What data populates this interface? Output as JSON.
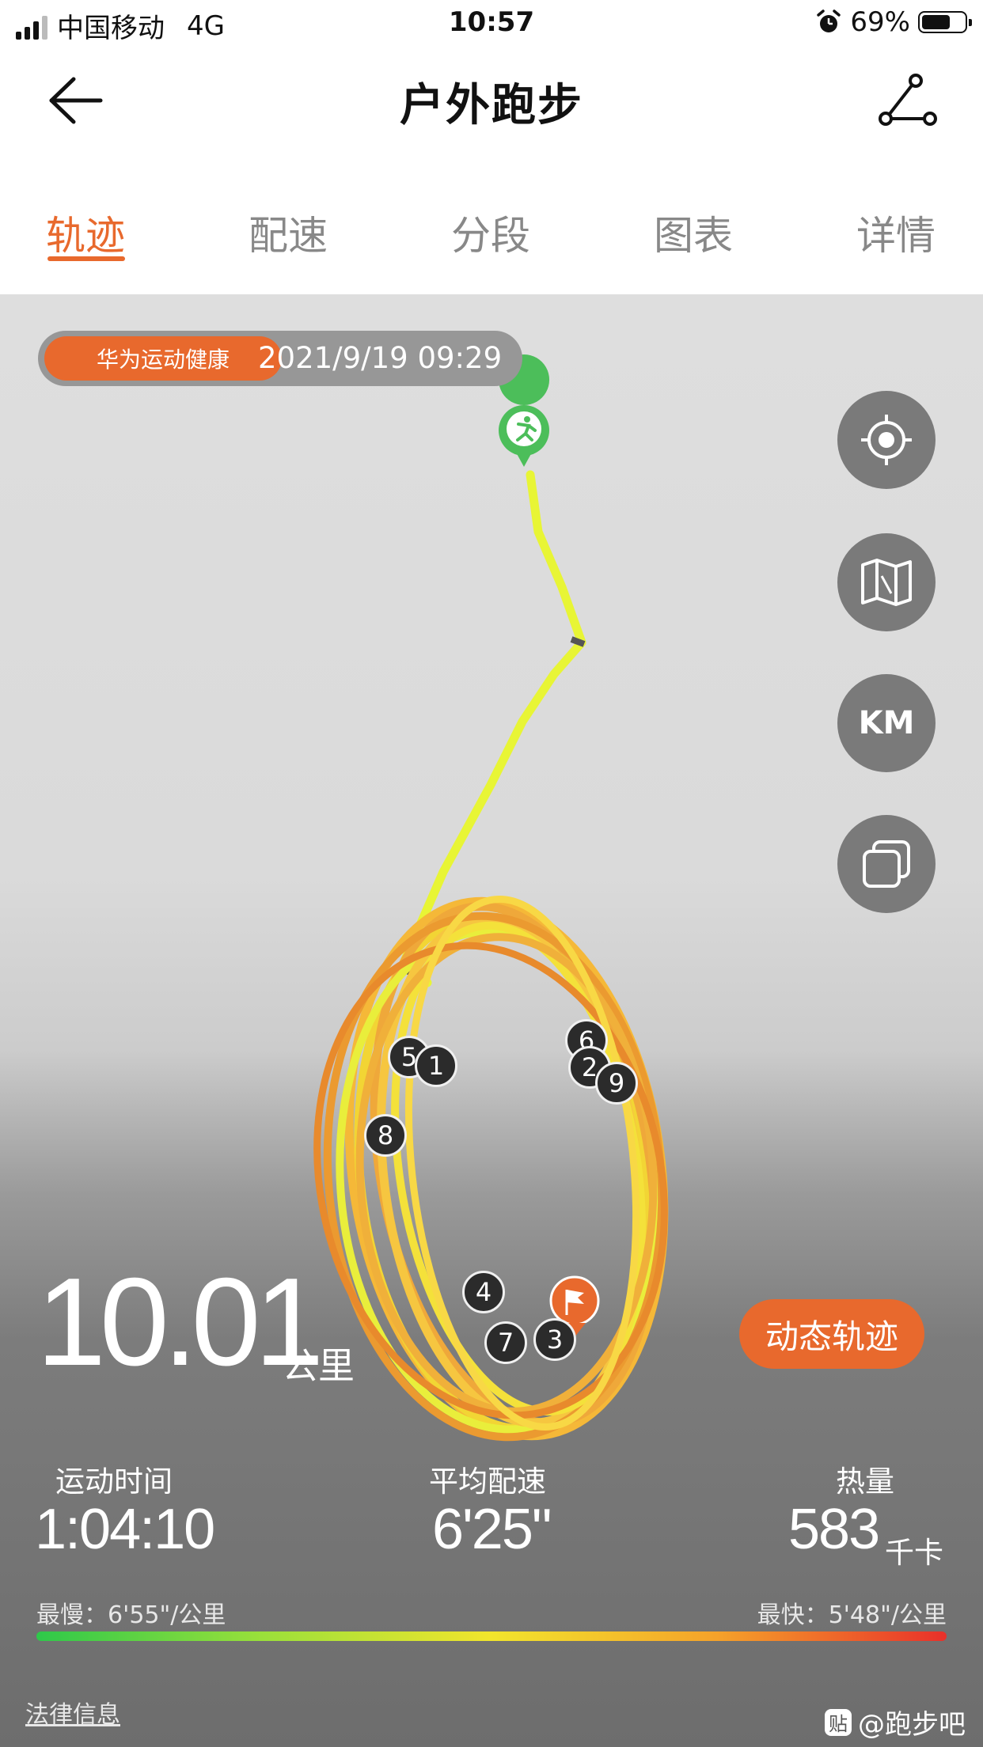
{
  "status_bar": {
    "carrier": "中国移动",
    "network": "4G",
    "time": "10:57",
    "battery": "69%",
    "battery_level": 0.69
  },
  "nav": {
    "title": "户外跑步"
  },
  "tabs": [
    {
      "label": "轨迹",
      "active": true
    },
    {
      "label": "配速",
      "active": false
    },
    {
      "label": "分段",
      "active": false
    },
    {
      "label": "图表",
      "active": false
    },
    {
      "label": "详情",
      "active": false
    }
  ],
  "map": {
    "source_tag": "华为运动健康",
    "start_time": "2021/9/19 09:29",
    "controls": {
      "km_label": "KM"
    },
    "km_markers": [
      "1",
      "2",
      "3",
      "4",
      "5",
      "6",
      "7",
      "8",
      "9"
    ],
    "dynamic_track_label": "动态轨迹"
  },
  "summary": {
    "distance": "10.01",
    "distance_unit": "公里",
    "duration_label": "运动时间",
    "duration": "1:04:10",
    "avg_pace_label": "平均配速",
    "avg_pace": "6'25\"",
    "calories_label": "热量",
    "calories": "583",
    "calories_unit": "千卡",
    "slowest": "最慢：6'55\"/公里",
    "fastest": "最快：5'48\"/公里"
  },
  "footer": {
    "legal": "法律信息",
    "watermark": "@跑步吧",
    "watermark_icon": "贴"
  },
  "colors": {
    "accent": "#e8692d",
    "start_pin": "#4cbe5a",
    "track_yellow": "#e8f535",
    "track_orange": "#f0a030"
  }
}
